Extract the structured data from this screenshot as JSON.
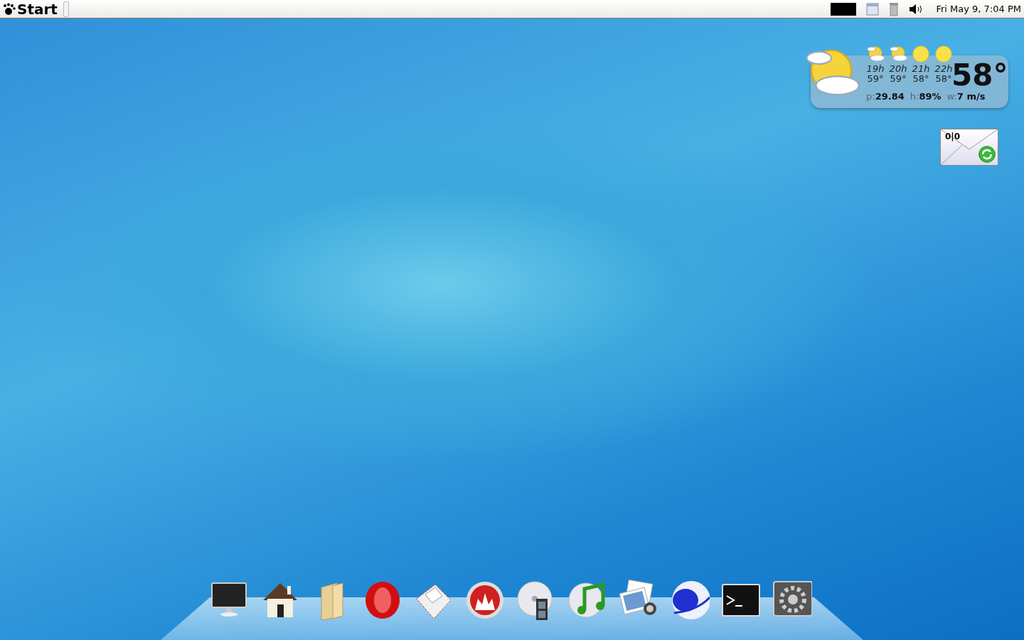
{
  "panel": {
    "start_label": "Start",
    "clock": "Fri May  9,  7:04 PM",
    "tray": [
      {
        "kind": "black"
      },
      {
        "kind": "window"
      },
      {
        "kind": "trash"
      },
      {
        "kind": "volume"
      }
    ]
  },
  "weather": {
    "now": {
      "kind": "cloudy"
    },
    "hours": [
      {
        "hour": "19h",
        "temp": "59°",
        "kind": "cloudy"
      },
      {
        "hour": "20h",
        "temp": "59°",
        "kind": "cloudy"
      },
      {
        "hour": "21h",
        "temp": "58°",
        "kind": "sunny"
      },
      {
        "hour": "22h",
        "temp": "58°",
        "kind": "sunny"
      }
    ],
    "current": "58°",
    "stats": [
      {
        "label": "p:",
        "value": "29.84"
      },
      {
        "label": "h:",
        "value": "89%"
      },
      {
        "label": "w:",
        "value": "7 m/s"
      }
    ]
  },
  "mail": {
    "count": "0|0"
  },
  "dock": [
    {
      "kind": "monitor"
    },
    {
      "kind": "home"
    },
    {
      "kind": "folder"
    },
    {
      "kind": "opera"
    },
    {
      "kind": "mail"
    },
    {
      "kind": "burn"
    },
    {
      "kind": "video"
    },
    {
      "kind": "music"
    },
    {
      "kind": "photos"
    },
    {
      "kind": "globe"
    },
    {
      "kind": "terminal"
    },
    {
      "kind": "settings"
    }
  ]
}
